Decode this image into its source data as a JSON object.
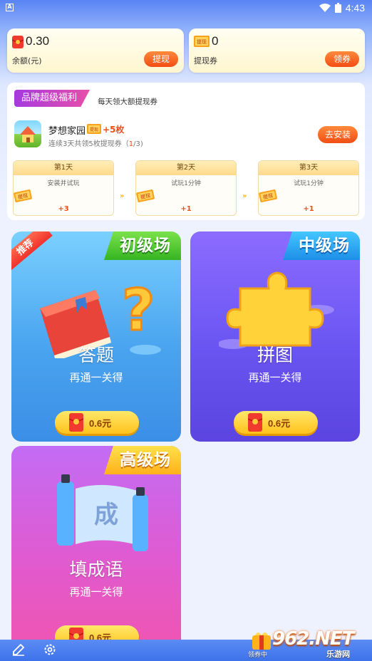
{
  "status_bar": {
    "time": "4:43",
    "left_badge": "A"
  },
  "balance": {
    "value": "0.30",
    "label": "余额(元)",
    "button": "提现"
  },
  "coupon": {
    "value": "0",
    "label": "提现券",
    "button": "领券",
    "icon_text": "提现"
  },
  "welfare": {
    "badge": "品牌超级福利",
    "subtitle": "每天领大额提现券",
    "app_name": "梦想家园",
    "ticket_text": "提现",
    "bonus": "+5枚",
    "desc_prefix": "连续3天共领5枚提现券（",
    "desc_progress": "1",
    "desc_suffix": "/3)",
    "install_button": "去安装",
    "days": [
      {
        "title": "第1天",
        "task": "安装并试玩",
        "reward": "+3"
      },
      {
        "title": "第2天",
        "task": "试玩1分钟",
        "reward": "+1"
      },
      {
        "title": "第3天",
        "task": "试玩1分钟",
        "reward": "+1"
      }
    ],
    "arrow": "»"
  },
  "games": [
    {
      "level": "初级场",
      "name": "答题",
      "subtitle": "再通一关得",
      "amount": "0.6元",
      "recommend": "推荐"
    },
    {
      "level": "中级场",
      "name": "拼图",
      "subtitle": "再通一关得",
      "amount": "0.6元"
    },
    {
      "level": "高级场",
      "name": "填成语",
      "subtitle": "再通一关得",
      "amount": "0.6元",
      "scroll_char": "成"
    }
  ],
  "watermark": {
    "brand": "962.NET",
    "site": "乐游网",
    "label": "领券中"
  },
  "colors": {
    "accent_orange": "#f34d14",
    "card_blue": "#4aa4ef",
    "card_purple": "#6a55f2",
    "card_pink": "#e05ad0"
  }
}
